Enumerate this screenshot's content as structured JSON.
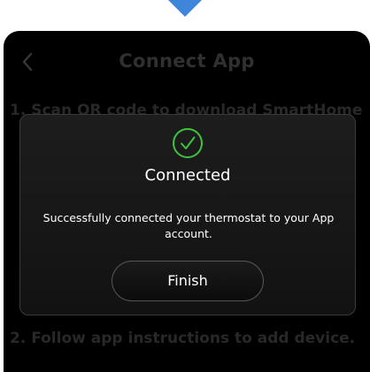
{
  "header": {
    "back_icon": "chevron-left-icon",
    "title": "Connect App"
  },
  "steps": {
    "step1": "1. Scan QR code to download SmartHome",
    "step2": "2. Follow app instructions to add device."
  },
  "dialog": {
    "icon": "check-circle-icon",
    "title": "Connected",
    "message": "Successfully connected your thermostat to your App account.",
    "finish_label": "Finish"
  },
  "colors": {
    "pointer": "#3d86d9",
    "success": "#3ec43e",
    "screen_bg": "#000000"
  }
}
